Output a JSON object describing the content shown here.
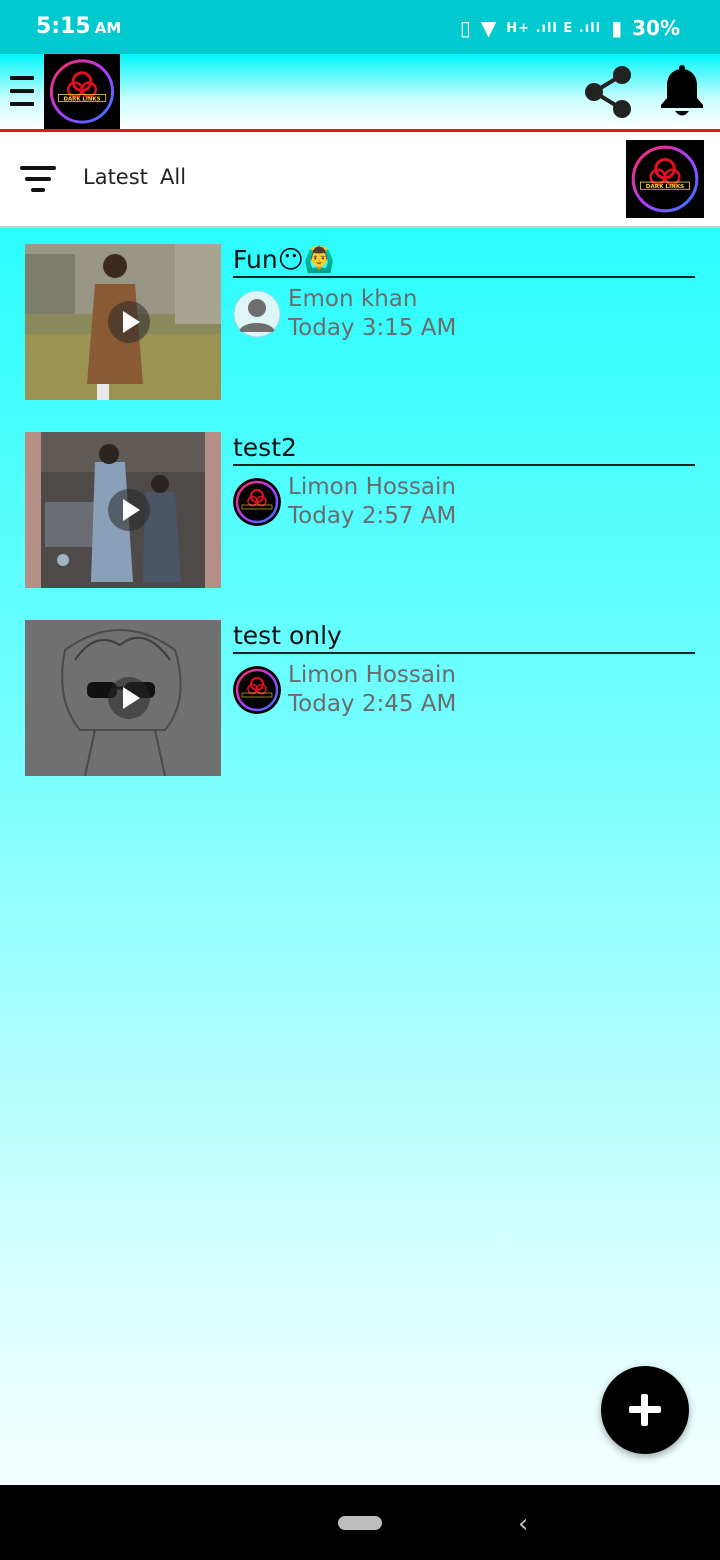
{
  "status_bar": {
    "time": "5:15",
    "ampm": "AM",
    "network_icons": "H+ .ıll E .ıll",
    "battery": "30%"
  },
  "app_bar": {
    "logo_text": "DARK LINKS",
    "icons": [
      "menu-icon",
      "share-icon",
      "bell-icon"
    ]
  },
  "filter": {
    "latest_label": "Latest",
    "all_label": "All"
  },
  "posts": [
    {
      "title": "Fun😶🙆‍♂️",
      "author": "Emon khan",
      "time": "Today 3:15 AM",
      "avatar": "default-avatar"
    },
    {
      "title": "test2",
      "author": "Limon Hossain",
      "time": "Today 2:57 AM",
      "avatar": "logo-avatar"
    },
    {
      "title": "test only",
      "author": "Limon Hossain",
      "time": "Today 2:45 AM",
      "avatar": "logo-avatar"
    }
  ],
  "fab": {
    "icon": "plus-icon"
  },
  "nav": {
    "back_glyph": "‹"
  },
  "colors": {
    "status_bar": "#00c9cf",
    "accent_line": "#e8141c",
    "content_top": "#2bfdfd",
    "text_secondary": "#6b6b6b"
  }
}
